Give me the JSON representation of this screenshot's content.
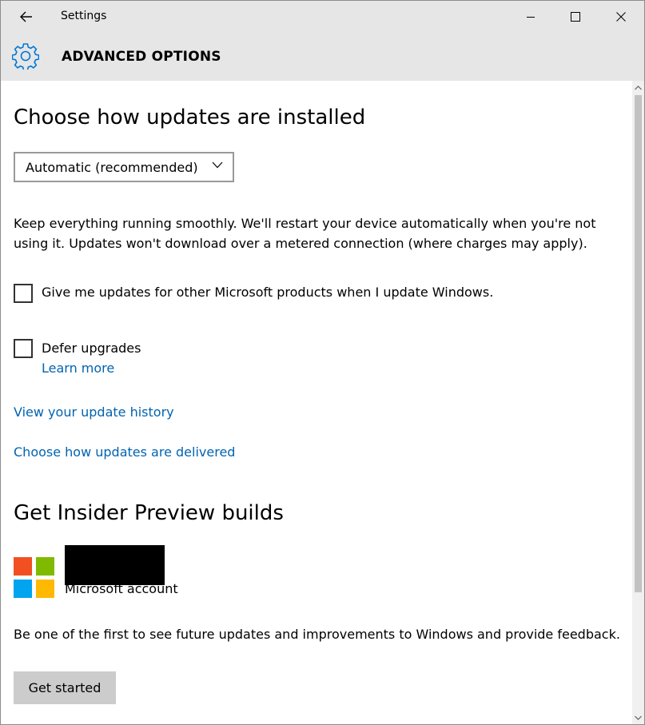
{
  "window": {
    "title": "Settings",
    "back_icon": "back-arrow-icon",
    "minimize_icon": "minimize-icon",
    "maximize_icon": "maximize-icon",
    "close_icon": "close-icon"
  },
  "header": {
    "icon": "gear-icon",
    "title": "ADVANCED OPTIONS",
    "accent_color": "#0078d7"
  },
  "updates": {
    "heading": "Choose how updates are installed",
    "install_mode": {
      "selected": "Automatic (recommended)",
      "icon": "chevron-down-icon"
    },
    "description": "Keep everything running smoothly. We'll restart your device automatically when you're not using it. Updates won't download over a metered connection (where charges may apply).",
    "other_products_checkbox": {
      "label": "Give me updates for other Microsoft products when I update Windows.",
      "checked": false
    },
    "defer_checkbox": {
      "label": "Defer upgrades",
      "checked": false
    },
    "learn_more_link": "Learn more",
    "history_link": "View your update history",
    "delivery_link": "Choose how updates are delivered"
  },
  "insider": {
    "heading": "Get Insider Preview builds",
    "logo_icon": "microsoft-logo-icon",
    "logo_colors": [
      "#f25022",
      "#7fba00",
      "#00a4ef",
      "#ffb900"
    ],
    "account_label": "Microsoft account",
    "description": "Be one of the first to see future updates and improvements to Windows and provide feedback.",
    "button_label": "Get started"
  },
  "colors": {
    "link": "#0063b1",
    "titlebar_bg": "#e6e6e6",
    "button_bg": "#cccccc"
  }
}
